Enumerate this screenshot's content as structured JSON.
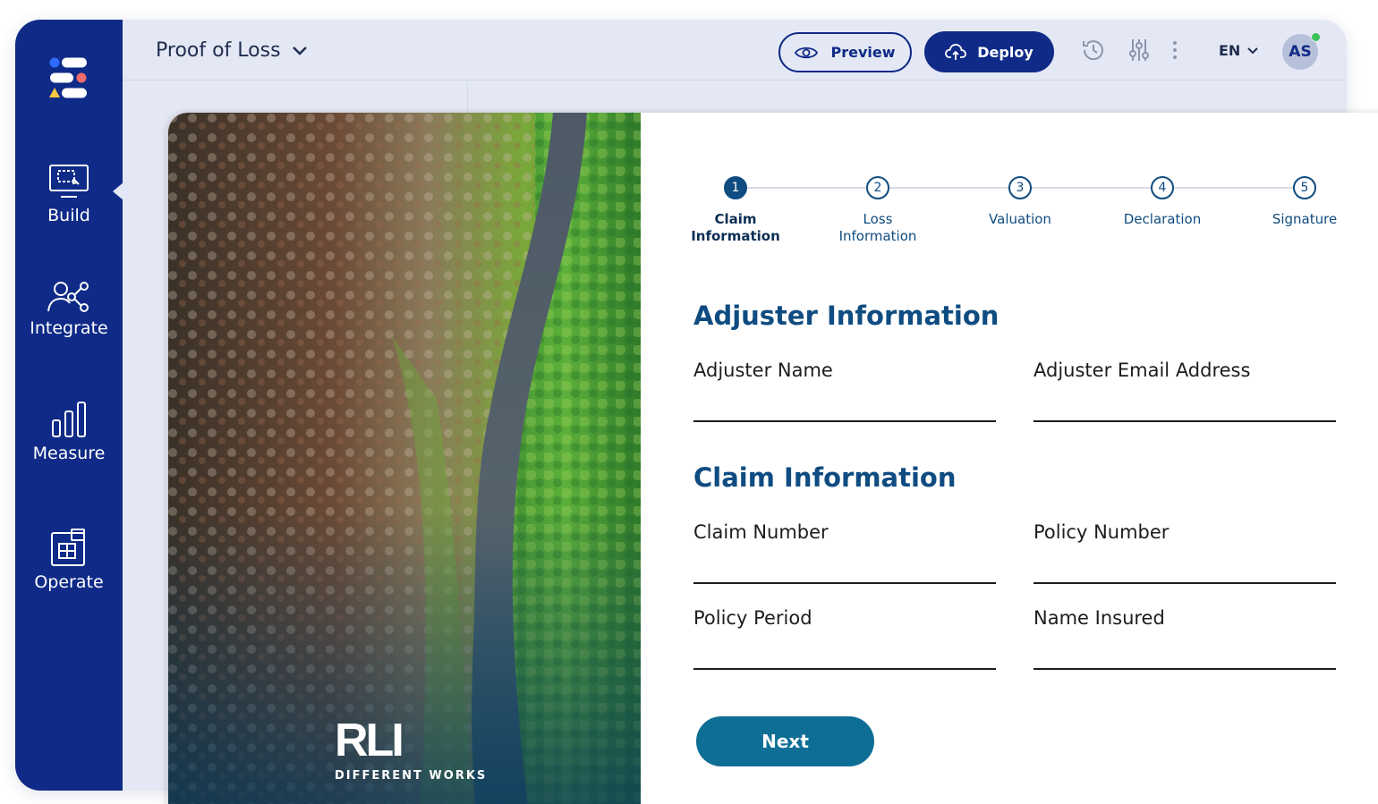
{
  "sidebar": {
    "items": [
      {
        "label": "Build",
        "icon": "monitor-icon",
        "active": true
      },
      {
        "label": "Integrate",
        "icon": "share-users-icon",
        "active": false
      },
      {
        "label": "Measure",
        "icon": "bar-chart-icon",
        "active": false
      },
      {
        "label": "Operate",
        "icon": "layout-grid-icon",
        "active": false
      }
    ]
  },
  "header": {
    "title": "Proof of Loss",
    "preview_label": "Preview",
    "deploy_label": "Deploy",
    "language": "EN",
    "avatar_initials": "AS",
    "icons": [
      "history-icon",
      "sliders-icon",
      "more-vertical-icon"
    ]
  },
  "brand": {
    "name": "RLI",
    "tagline": "DIFFERENT WORKS"
  },
  "stepper": {
    "steps": [
      {
        "num": "1",
        "line1": "Claim",
        "line2": "Information",
        "active": true
      },
      {
        "num": "2",
        "line1": "Loss",
        "line2": "Information",
        "active": false
      },
      {
        "num": "3",
        "line1": "Valuation",
        "line2": "",
        "active": false
      },
      {
        "num": "4",
        "line1": "Declaration",
        "line2": "",
        "active": false
      },
      {
        "num": "5",
        "line1": "Signature",
        "line2": "",
        "active": false
      }
    ]
  },
  "form": {
    "adjuster_section": "Adjuster Information",
    "adjuster_name_label": "Adjuster Name",
    "adjuster_email_label": "Adjuster Email Address",
    "claim_section": "Claim Information",
    "claim_number_label": "Claim Number",
    "policy_number_label": "Policy Number",
    "policy_period_label": "Policy Period",
    "name_insured_label": "Name Insured",
    "next_label": "Next"
  },
  "colors": {
    "sidebar": "#0f2a87",
    "accent": "#0f4c81",
    "next_button": "#0e6e96",
    "status_online": "#3cc25a"
  }
}
